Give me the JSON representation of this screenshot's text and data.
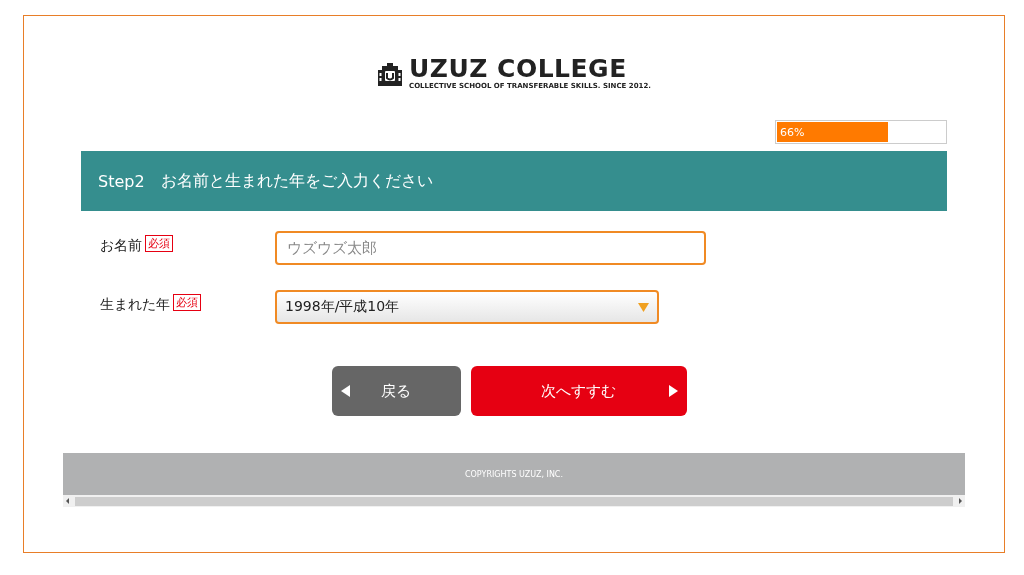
{
  "logo": {
    "title": "UZUZ COLLEGE",
    "tagline": "COLLECTIVE SCHOOL OF TRANSFERABLE SKILLS. SINCE 2012."
  },
  "progress": {
    "level": 0.66,
    "label": "66%"
  },
  "step": {
    "number": "Step2",
    "title": "お名前と生まれた年をご入力ください"
  },
  "fields": [
    {
      "kind": "text",
      "label": "お名前",
      "badge": "必須",
      "placeholder": "ウズウズ太郎"
    },
    {
      "kind": "select",
      "label": "生まれた年",
      "badge": "必須",
      "value": "1998年/平成10年"
    }
  ],
  "buttons": [
    {
      "kind": "back",
      "label": "戻る"
    },
    {
      "kind": "next",
      "label": "次へすすむ"
    }
  ],
  "footer": {
    "copyright": "COPYRIGHTS UZUZ, INC."
  }
}
